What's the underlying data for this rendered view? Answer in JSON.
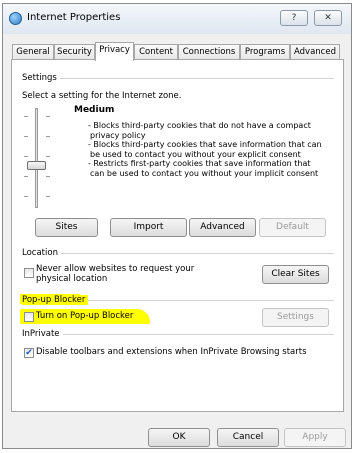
{
  "window": {
    "title": "Internet Properties",
    "help_glyph": "?",
    "close_glyph": "✕"
  },
  "tabs": [
    "General",
    "Security",
    "Privacy",
    "Content",
    "Connections",
    "Programs",
    "Advanced"
  ],
  "active_tab": "Privacy",
  "settings": {
    "heading": "Settings",
    "instruction": "Select a setting for the Internet zone.",
    "level": "Medium",
    "description": [
      "- Blocks third-party cookies that do not have a compact",
      "privacy policy",
      "- Blocks third-party cookies that save information that can",
      "be used to contact you without your explicit consent",
      "- Restricts first-party cookies that save information that",
      "can be used to contact you without your implicit consent"
    ],
    "buttons": {
      "sites": "Sites",
      "import": "Import",
      "advanced": "Advanced",
      "default": "Default"
    }
  },
  "location": {
    "heading": "Location",
    "checkbox_label_line1": "Never allow websites to request your",
    "checkbox_label_line2": "physical location",
    "checked": false,
    "clear_sites": "Clear Sites"
  },
  "popup": {
    "heading": "Pop-up Blocker",
    "checkbox_label": "Turn on Pop-up Blocker",
    "checked": false,
    "settings_button": "Settings",
    "highlight_color": "#ffff00"
  },
  "inprivate": {
    "heading": "InPrivate",
    "checkbox_label": "Disable toolbars and extensions when InPrivate Browsing starts",
    "checked": true
  },
  "footer": {
    "ok": "OK",
    "cancel": "Cancel",
    "apply": "Apply"
  }
}
